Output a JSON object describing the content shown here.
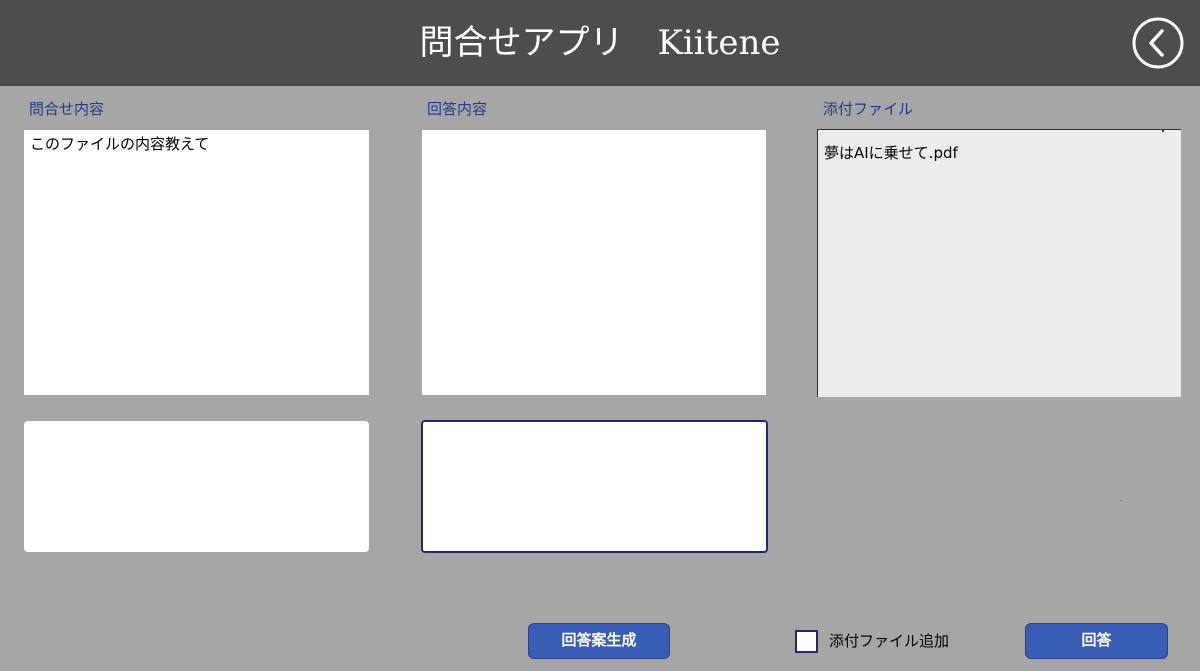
{
  "header": {
    "title": "問合せアプリ　Kiitene",
    "back_icon": "chevron-left-circle-icon"
  },
  "columns": {
    "inquiry": {
      "label": "問合せ内容",
      "text": "このファイルの内容教えて"
    },
    "answer": {
      "label": "回答内容",
      "text": ""
    },
    "attachment": {
      "label": "添付ファイル",
      "file_name": "夢はAIに乗せて.pdf"
    }
  },
  "actions": {
    "generate_label": "回答案生成",
    "attach_checkbox_label": "添付ファイル追加",
    "attach_checked": false,
    "answer_label": "回答"
  },
  "colors": {
    "header_bg": "#4d4d4d",
    "page_bg": "#a6a6a6",
    "label_text": "#1f3a8a",
    "button_bg": "#3a5db5",
    "border_accent": "#1f2a6b"
  }
}
